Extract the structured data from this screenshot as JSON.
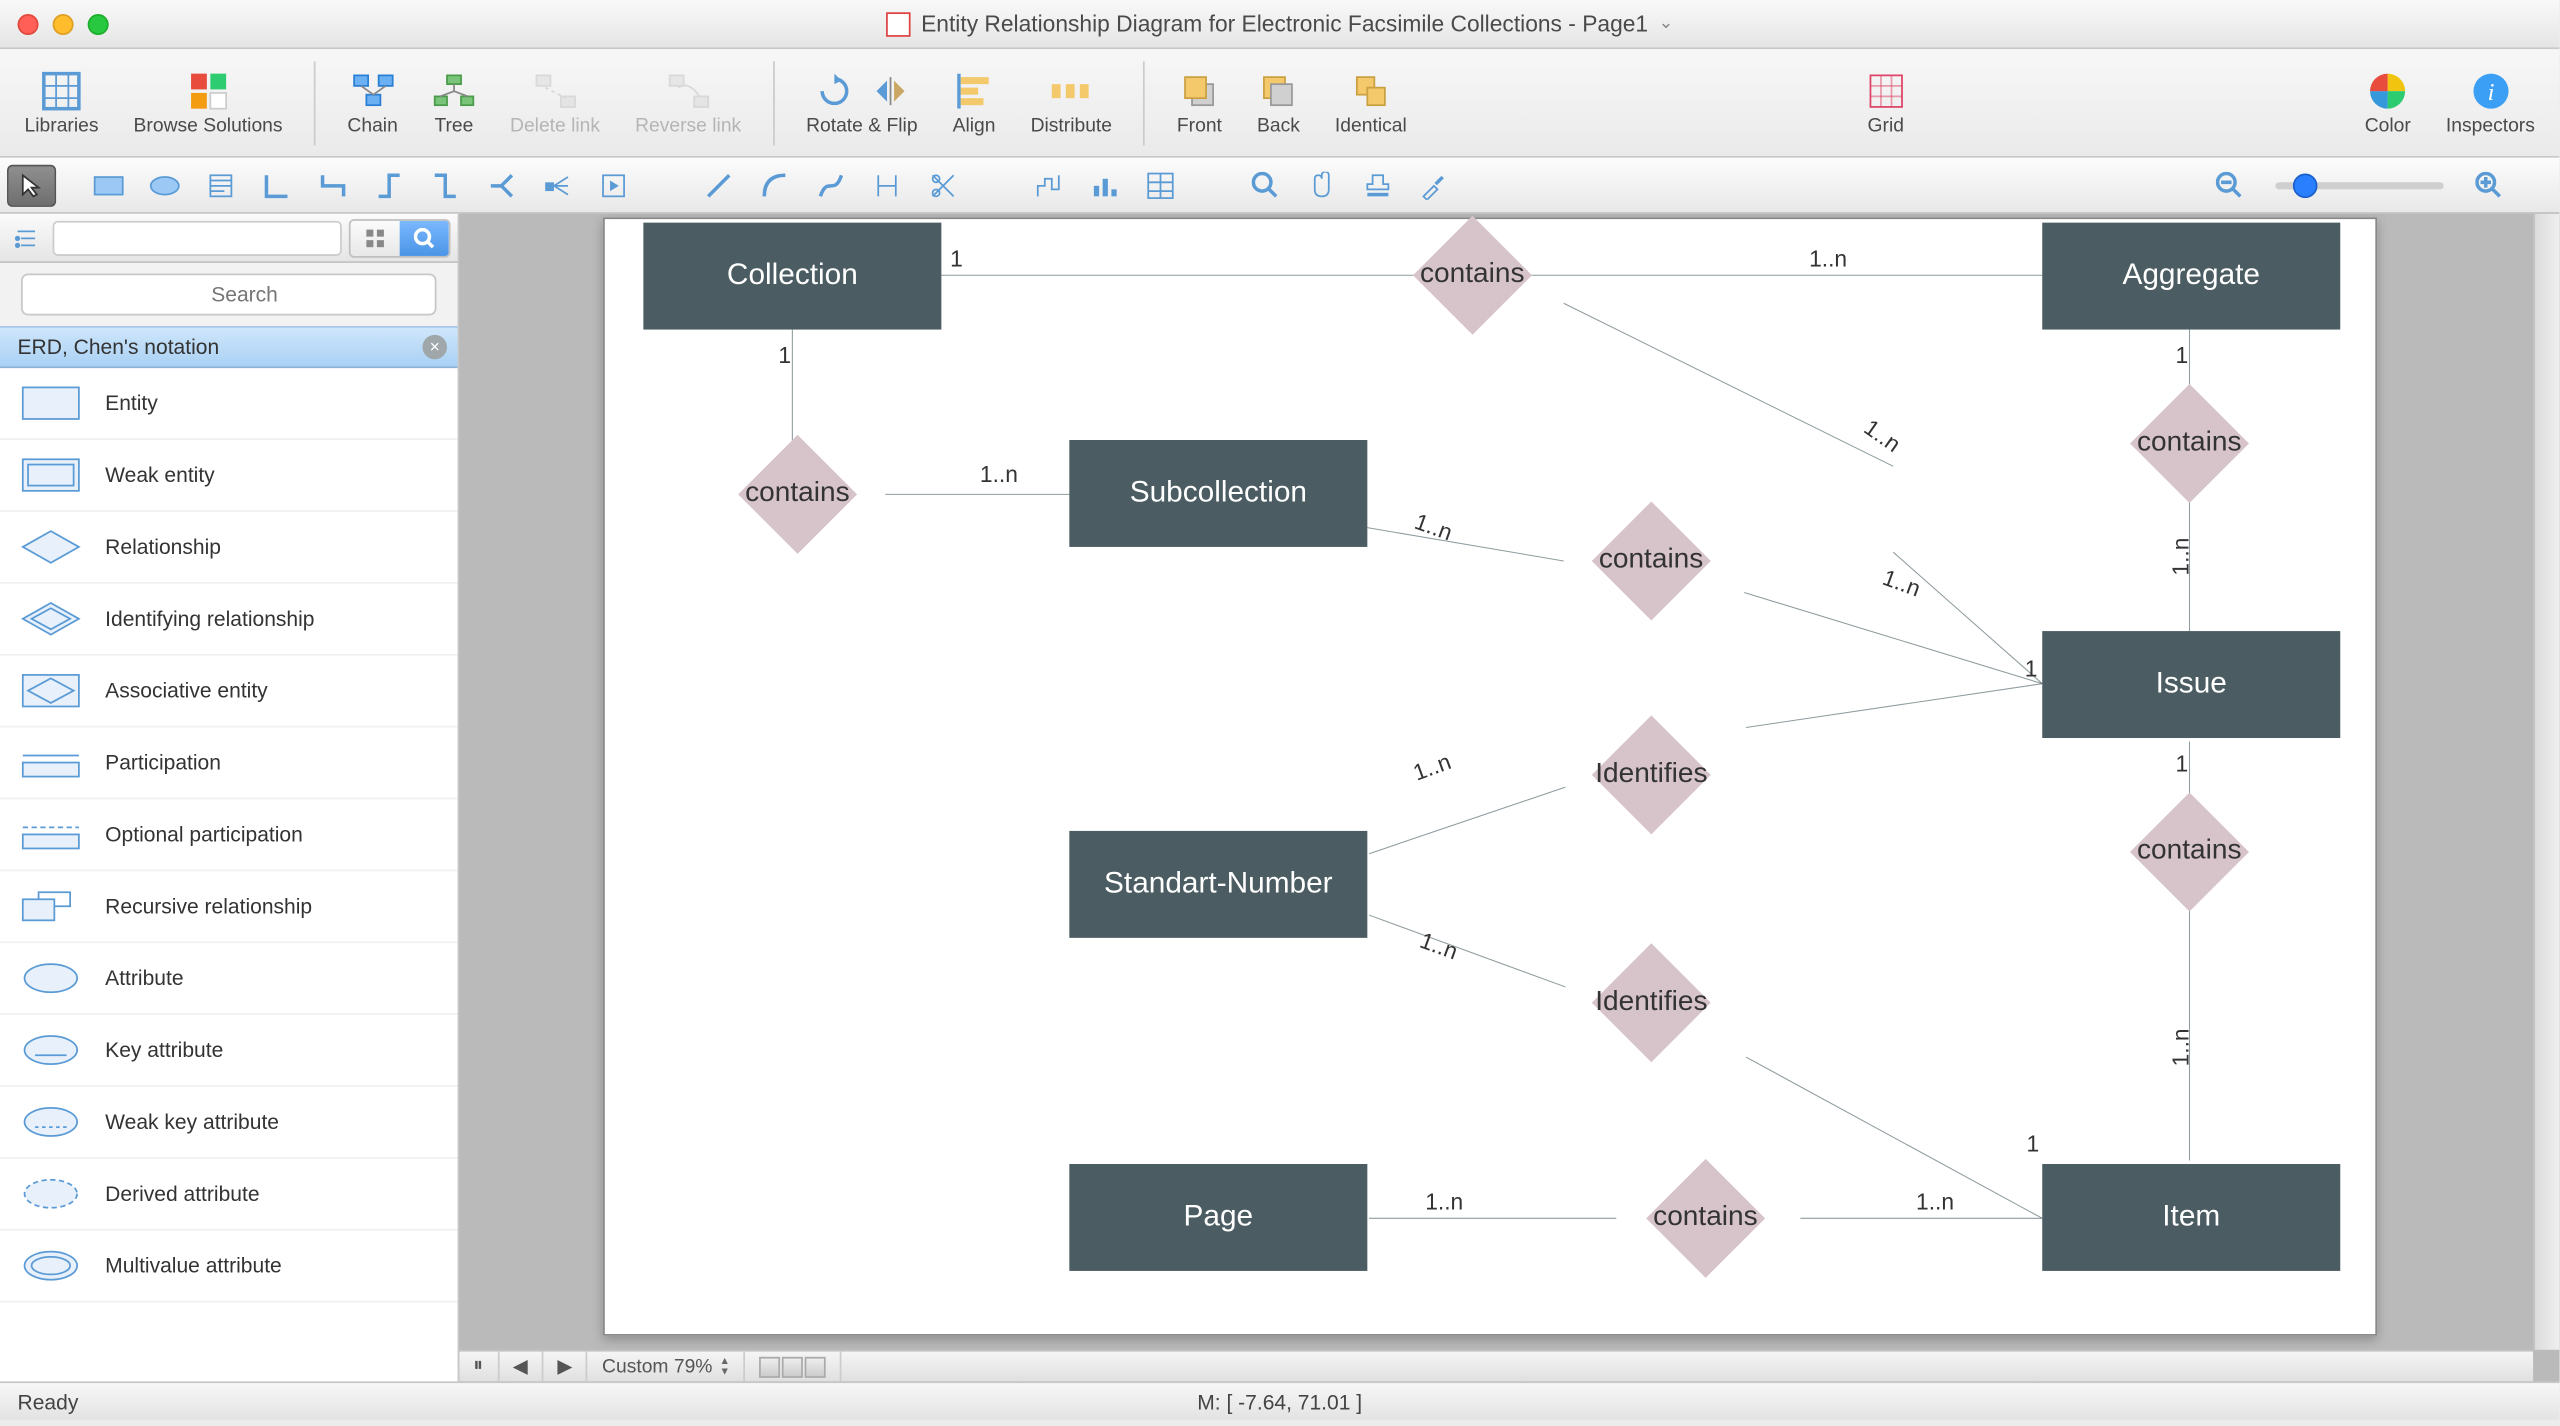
{
  "title": "Entity Relationship Diagram for Electronic Facsimile Collections - Page1",
  "toolbar": {
    "libraries": "Libraries",
    "browse_solutions": "Browse Solutions",
    "chain": "Chain",
    "tree": "Tree",
    "delete_link": "Delete link",
    "reverse_link": "Reverse link",
    "rotate_flip": "Rotate & Flip",
    "align": "Align",
    "distribute": "Distribute",
    "front": "Front",
    "back": "Back",
    "identical": "Identical",
    "grid": "Grid",
    "color": "Color",
    "inspectors": "Inspectors"
  },
  "sidebar": {
    "search_placeholder": "Search",
    "category": "ERD, Chen's notation",
    "items": [
      "Entity",
      "Weak entity",
      "Relationship",
      "Identifying relationship",
      "Associative entity",
      "Participation",
      "Optional participation",
      "Recursive relationship",
      "Attribute",
      "Key attribute",
      "Weak key attribute",
      "Derived attribute",
      "Multivalue attribute"
    ]
  },
  "canvas": {
    "entities": {
      "collection": "Collection",
      "aggregate": "Aggregate",
      "subcollection": "Subcollection",
      "issue": "Issue",
      "standart_number": "Standart-Number",
      "page": "Page",
      "item": "Item"
    },
    "relationships": {
      "contains1": "contains",
      "contains2": "contains",
      "contains3": "contains",
      "contains4": "contains",
      "contains5": "contains",
      "contains6": "contains",
      "identifies1": "Identifies",
      "identifies2": "Identifies"
    },
    "cardinalities": {
      "c1": "1",
      "c2": "1..n",
      "c3": "1",
      "c4": "1",
      "c5": "1..n",
      "c6": "1..n",
      "c7": "1..n",
      "c8": "1..n",
      "c9": "1",
      "c10": "1",
      "c11": "1..n",
      "c12": "1..n",
      "c13": "1..n",
      "c14": "1",
      "c15": "1..n",
      "c16": "1..n"
    }
  },
  "bottombar": {
    "zoom": "Custom 79%"
  },
  "statusbar": {
    "ready": "Ready",
    "mouse": "M: [ -7.64, 71.01 ]"
  }
}
